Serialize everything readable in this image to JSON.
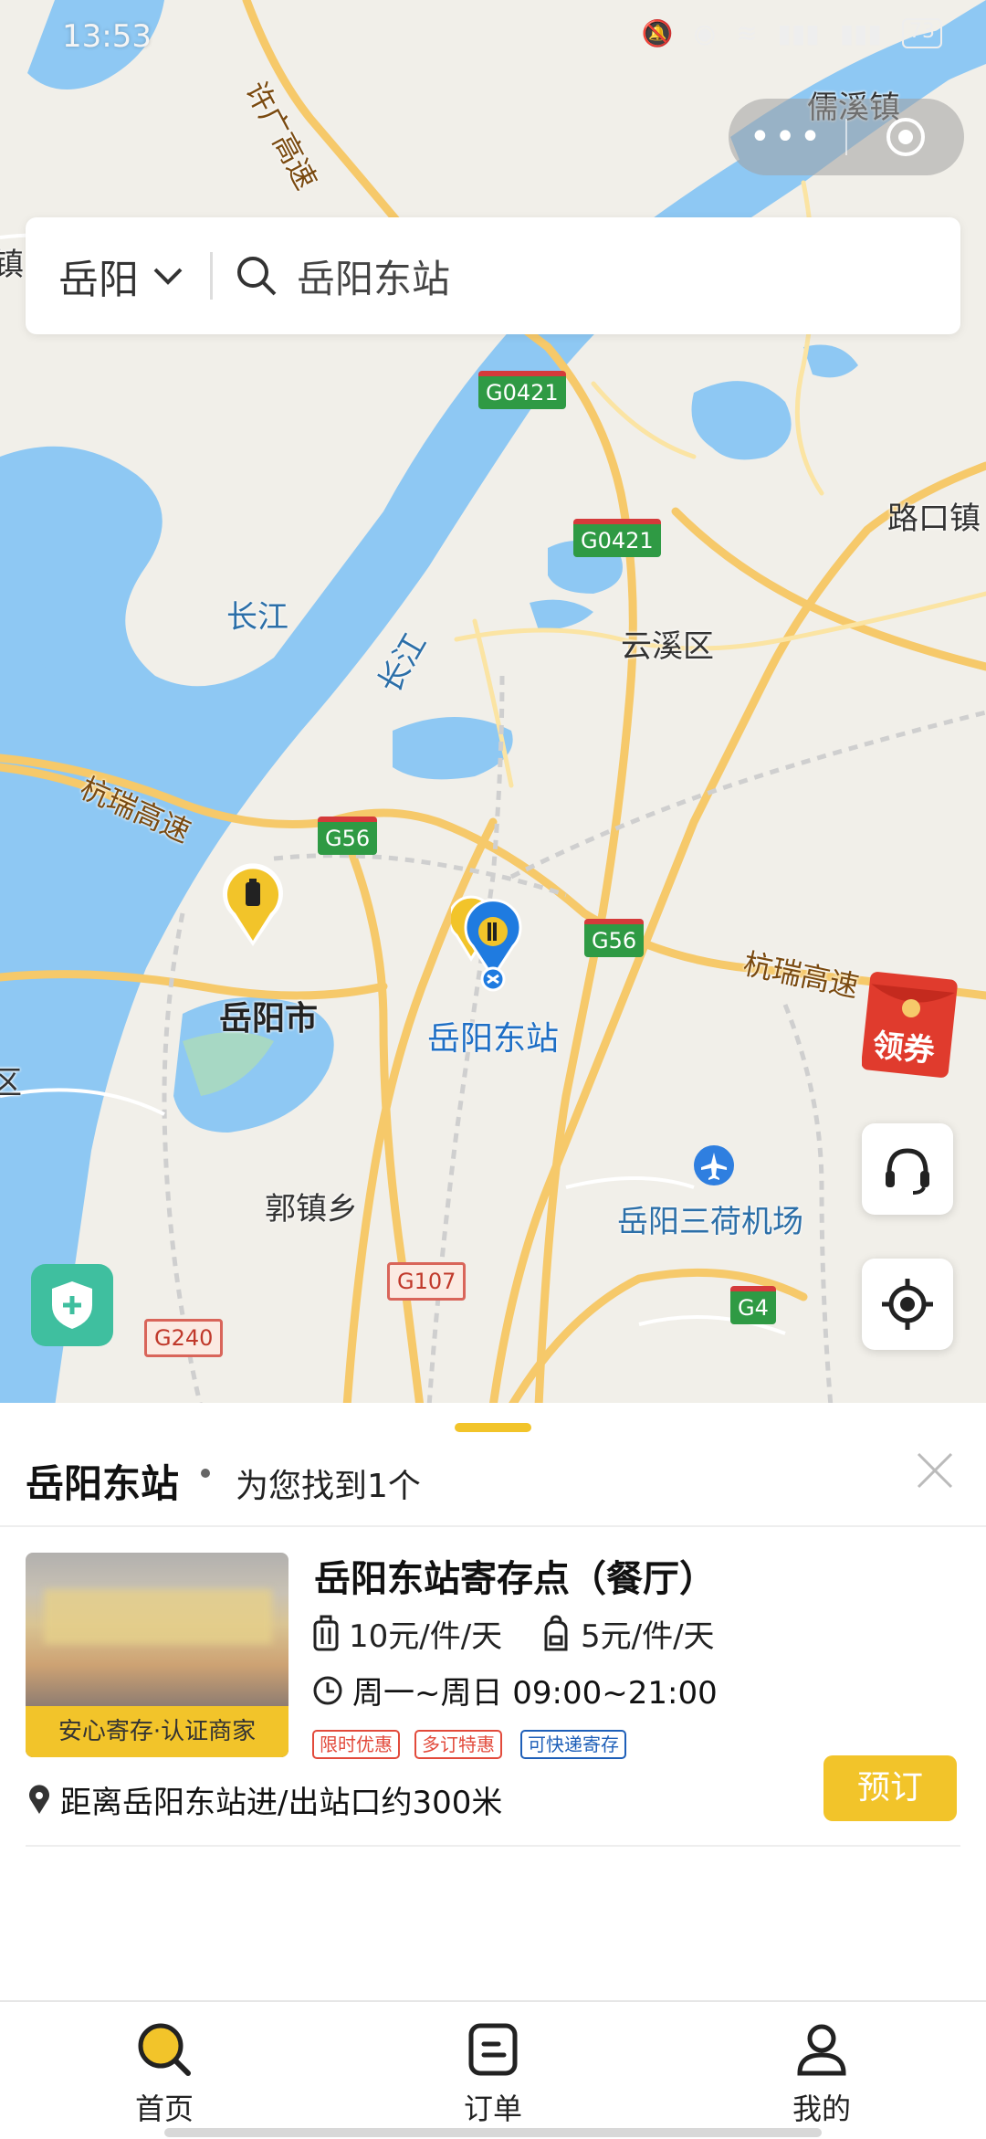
{
  "status_bar": {
    "time": "13:53",
    "icons": [
      "bell-mute-icon",
      "location-icon",
      "wifi-icon",
      "signal-icon",
      "signal-icon",
      "battery-icon"
    ],
    "battery": "73"
  },
  "capsule": {
    "more": "•••",
    "close_icon": "target-icon"
  },
  "search": {
    "city": "岳阳",
    "query": "岳阳东站"
  },
  "map": {
    "labels": {
      "xuguang": "许广高速",
      "ruxi": "儒溪镇",
      "lukou": "路口镇",
      "changjiang": "长江",
      "jiang": "江",
      "changjiang2": "长江",
      "yunxi": "云溪区",
      "hangrui_left": "杭瑞高速",
      "hangrui_right": "杭瑞高速",
      "yueyang_city": "岳阳市",
      "yueyang_east": "岳阳东站",
      "guozhen": "郭镇乡",
      "airport": "岳阳三荷机场",
      "edge_left1": "镇",
      "edge_left2": "区"
    },
    "shields": {
      "g0421a": "G0421",
      "g0421b": "G0421",
      "g56a": "G56",
      "g56b": "G56",
      "g107": "G107",
      "g240": "G240",
      "g4": "G4"
    }
  },
  "floating": {
    "coupon": "领券",
    "service_icon": "headset-icon",
    "locate_icon": "locate-icon",
    "shield_icon": "shield-plus-icon"
  },
  "sheet": {
    "title": "岳阳东站",
    "subtitle": "为您找到1个",
    "store": {
      "name": "岳阳东站寄存点（餐厅）",
      "badge": "安心寄存·认证商家",
      "price_luggage": "10元/件/天",
      "price_bag": "5元/件/天",
      "hours": "周一~周日 09:00~21:00",
      "tags": [
        "限时优惠",
        "多订特惠",
        "可快递寄存"
      ],
      "distance": "距离岳阳东站进/出站口约300米",
      "book": "预订"
    }
  },
  "tabs": [
    {
      "label": "首页",
      "icon": "search-icon"
    },
    {
      "label": "订单",
      "icon": "order-icon"
    },
    {
      "label": "我的",
      "icon": "user-icon"
    }
  ],
  "colors": {
    "accent": "#f2c42a",
    "water": "#8ec8f3",
    "road_major": "#f6c96a",
    "marker_blue": "#1f7be0"
  }
}
